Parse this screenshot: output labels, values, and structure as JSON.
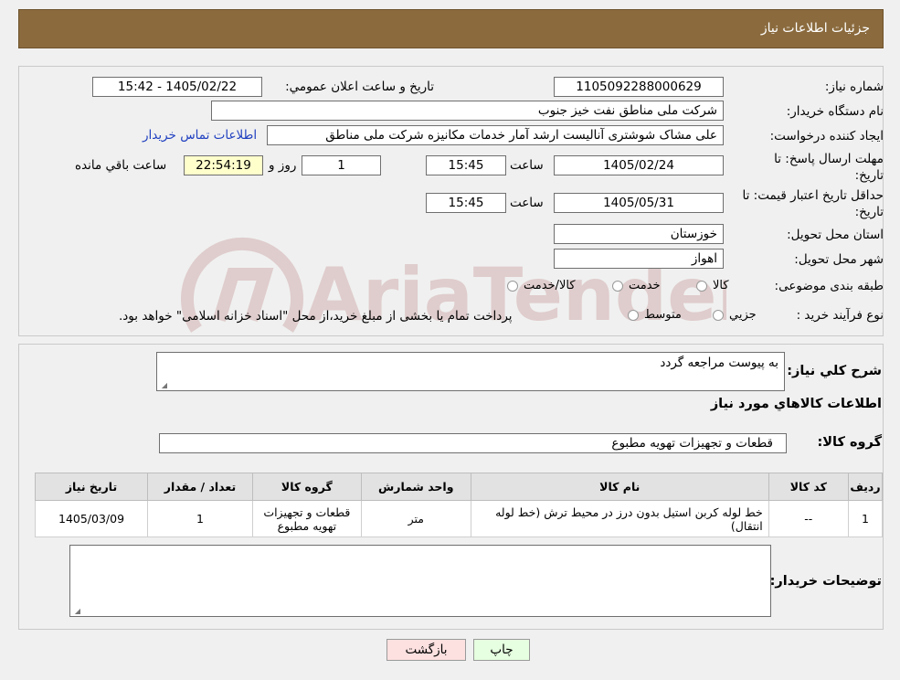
{
  "header": {
    "title": "جزئیات اطلاعات نیاز"
  },
  "fields": {
    "need_number_label": "شماره نیاز:",
    "need_number": "1105092288000629",
    "announce_label": "تاريخ و ساعت اعلان عمومي:",
    "announce_value": "1405/02/22 - 15:42",
    "buyer_label": "نام دستگاه خریدار:",
    "buyer_value": "شرکت ملی مناطق نفت خیز جنوب",
    "creator_label": "ایجاد کننده درخواست:",
    "creator_value": "علی  مشاک شوشتری  آنالیست ارشد آمار خدمات مکانیزه شرکت ملی مناطق",
    "contact_link": "اطلاعات تماس خریدار",
    "deadline_label_1": "مهلت ارسال پاسخ: تا",
    "deadline_label_2": "تاریخ:",
    "deadline_date": "1405/02/24",
    "time_label": "ساعت",
    "deadline_time": "15:45",
    "days_value": "1",
    "days_label": "روز و",
    "remaining_time": "22:54:19",
    "remaining_label": "ساعت باقي مانده",
    "validity_label_1": "حداقل تاریخ اعتبار قیمت: تا",
    "validity_label_2": "تاریخ:",
    "validity_date": "1405/05/31",
    "validity_time": "15:45",
    "province_label": "استان محل تحویل:",
    "province_value": "خوزستان",
    "city_label": "شهر محل تحویل:",
    "city_value": "اهواز",
    "category_label": "طبقه بندی موضوعی:",
    "category_options": [
      "کالا",
      "خدمت",
      "کالا/خدمت"
    ],
    "process_label": "نوع فرآیند خرید :",
    "process_options": [
      "جزيي",
      "متوسط"
    ],
    "process_note": "پرداخت تمام یا بخشی از مبلغ خرید،از محل \"اسناد خزانه اسلامی\" خواهد بود."
  },
  "general": {
    "desc_label": "شرح کلي نياز:",
    "desc_value": "به پیوست مراجعه گردد",
    "goods_title": "اطلاعات کالاهاي مورد نياز",
    "group_label": "گروه کالا:",
    "group_value": "قطعات و تجهیزات تهویه مطبوع"
  },
  "table": {
    "headers": [
      "رديف",
      "کد کالا",
      "نام کالا",
      "واحد شمارش",
      "گروه کالا",
      "تعداد / مقدار",
      "تاریخ نیاز"
    ],
    "rows": [
      [
        "1",
        "--",
        "خط لوله کربن استیل بدون درز در محیط ترش (خط لوله انتقال)",
        "متر",
        "قطعات و تجهیزات تهویه مطبوع",
        "1",
        "1405/03/09"
      ]
    ]
  },
  "buyer_notes": {
    "label": "توضیحات خریدار:",
    "value": ""
  },
  "buttons": {
    "print": "چاپ",
    "back": "بازگشت"
  },
  "watermark": {
    "text": "AriaTender.neT"
  },
  "colors": {
    "header_bg": "#8b6b3e",
    "remaining_bg": "#ffffcc",
    "link": "#2040c0",
    "back_btn": "#fde0e0",
    "print_btn": "#e6ffe0"
  }
}
